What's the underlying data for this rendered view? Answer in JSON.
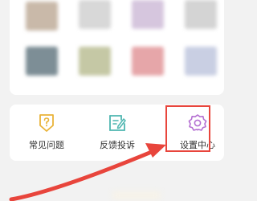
{
  "thumbnails": [
    {
      "name": "thumb-1",
      "color": "#c9b9a9"
    },
    {
      "name": "thumb-2",
      "color": "#d8d8d8"
    },
    {
      "name": "thumb-3",
      "color": "#d6c6de"
    },
    {
      "name": "thumb-4",
      "color": "#d4d4d4"
    },
    {
      "name": "thumb-5",
      "color": "#7d8e96"
    },
    {
      "name": "thumb-6",
      "color": "#c5c8a5"
    },
    {
      "name": "thumb-7",
      "color": "#e6a6a9"
    },
    {
      "name": "thumb-8",
      "color": "#c9cfe3"
    }
  ],
  "services": [
    {
      "label": "常见问题",
      "icon": "question-shield-icon",
      "color": "#e9b338"
    },
    {
      "label": "反馈投诉",
      "icon": "feedback-edit-icon",
      "color": "#4fb6b0"
    },
    {
      "label": "设置中心",
      "icon": "settings-gear-icon",
      "color": "#b46fd2"
    }
  ],
  "annotation": {
    "color": "#e8453c"
  }
}
